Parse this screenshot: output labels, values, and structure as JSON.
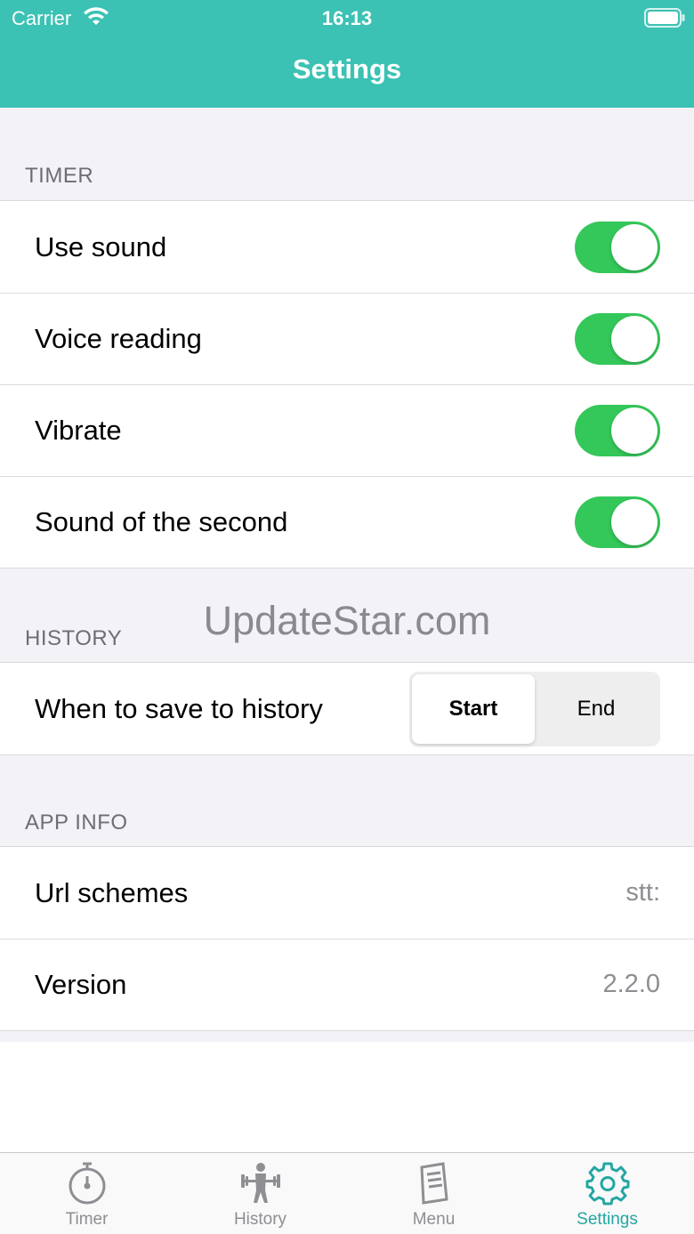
{
  "status_bar": {
    "carrier": "Carrier",
    "time": "16:13"
  },
  "nav": {
    "title": "Settings"
  },
  "sections": {
    "timer": {
      "header": "TIMER",
      "rows": [
        {
          "label": "Use sound",
          "on": true
        },
        {
          "label": "Voice reading",
          "on": true
        },
        {
          "label": "Vibrate",
          "on": true
        },
        {
          "label": "Sound of the second",
          "on": true
        }
      ]
    },
    "history": {
      "header": "HISTORY",
      "row_label": "When to save to history",
      "options": [
        "Start",
        "End"
      ],
      "selected": "Start"
    },
    "app_info": {
      "header": "APP INFO",
      "rows": [
        {
          "label": "Url schemes",
          "value": "stt:"
        },
        {
          "label": "Version",
          "value": "2.2.0"
        }
      ]
    }
  },
  "watermark": "UpdateStar.com",
  "tabbar": {
    "items": [
      {
        "label": "Timer",
        "icon": "stopwatch-icon"
      },
      {
        "label": "History",
        "icon": "weightlifter-icon"
      },
      {
        "label": "Menu",
        "icon": "document-icon"
      },
      {
        "label": "Settings",
        "icon": "gear-icon"
      }
    ],
    "active": "Settings"
  },
  "colors": {
    "nav_background": "#3bc2b4",
    "toggle_on": "#34c759",
    "tab_active": "#23a6a2",
    "tab_inactive": "#8e8e93"
  }
}
